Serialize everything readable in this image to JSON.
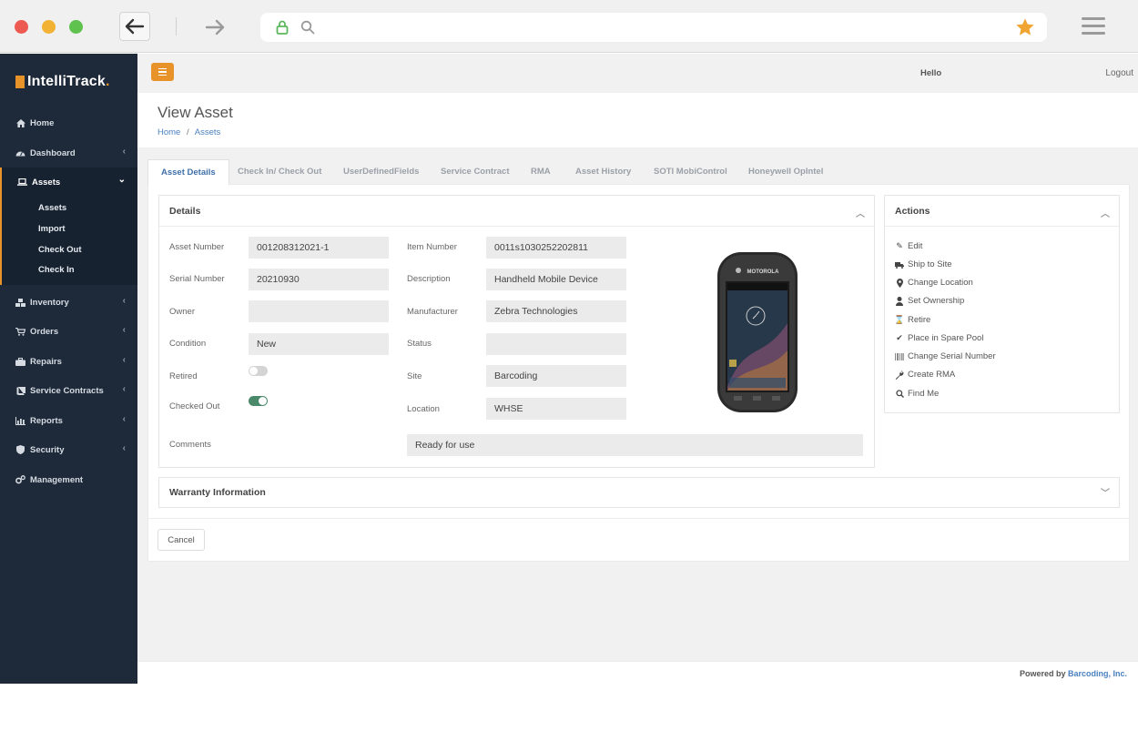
{
  "browser": {
    "colors": {
      "close": "#ed5a52",
      "minimize": "#f2b233",
      "maximize": "#5fc14e",
      "star": "#f0a432",
      "lock": "#5cb85c"
    }
  },
  "sidebar": {
    "brand": "IntelliTrack",
    "brand_dot": ".",
    "items": [
      {
        "label": "Home",
        "icon": "home-icon"
      },
      {
        "label": "Dashboard",
        "icon": "dashboard-icon"
      },
      {
        "label": "Assets",
        "icon": "laptop-icon"
      },
      {
        "label": "Inventory",
        "icon": "cubes-icon"
      },
      {
        "label": "Orders",
        "icon": "cart-icon"
      },
      {
        "label": "Repairs",
        "icon": "toolbox-icon"
      },
      {
        "label": "Service Contracts",
        "icon": "book-icon"
      },
      {
        "label": "Reports",
        "icon": "bar-chart-icon"
      },
      {
        "label": "Security",
        "icon": "shield-icon"
      },
      {
        "label": "Management",
        "icon": "cogs-icon"
      }
    ],
    "assets_sub": [
      "Assets",
      "Import",
      "Check Out",
      "Check In"
    ]
  },
  "topbar": {
    "hello": "Hello",
    "logout": "Logout"
  },
  "page": {
    "title": "View Asset",
    "breadcrumb": {
      "home": "Home",
      "sep": "/",
      "current": "Assets"
    }
  },
  "tabs": [
    "Asset Details",
    "Check In/ Check Out",
    "UserDefinedFields",
    "Service Contract",
    "RMA",
    "Asset History",
    "SOTI MobiControl",
    "Honeywell OpIntel"
  ],
  "details": {
    "title": "Details",
    "asset_number": {
      "label": "Asset Number",
      "value": "001208312021-1"
    },
    "serial_number": {
      "label": "Serial Number",
      "value": "20210930"
    },
    "owner": {
      "label": "Owner",
      "value": ""
    },
    "condition": {
      "label": "Condition",
      "value": "New"
    },
    "retired": {
      "label": "Retired",
      "on": false
    },
    "checked_out": {
      "label": "Checked Out",
      "on": true
    },
    "comments": {
      "label": "Comments",
      "value": "Ready for use"
    },
    "item_number": {
      "label": "Item Number",
      "value": "0011s1030252202811"
    },
    "description": {
      "label": "Description",
      "value": "Handheld Mobile Device"
    },
    "manufacturer": {
      "label": "Manufacturer",
      "value": "Zebra Technologies"
    },
    "status": {
      "label": "Status",
      "value": ""
    },
    "site": {
      "label": "Site",
      "value": "Barcoding"
    },
    "location": {
      "label": "Location",
      "value": "WHSE"
    },
    "device_brand": "MOTOROLA"
  },
  "actions": {
    "title": "Actions",
    "items": [
      {
        "label": "Edit",
        "icon": "pencil-icon"
      },
      {
        "label": "Ship to Site",
        "icon": "truck-icon"
      },
      {
        "label": "Change Location",
        "icon": "map-marker-icon"
      },
      {
        "label": "Set Ownership",
        "icon": "user-icon"
      },
      {
        "label": "Retire",
        "icon": "hourglass-icon"
      },
      {
        "label": "Place in Spare Pool",
        "icon": "check-icon"
      },
      {
        "label": "Change Serial Number",
        "icon": "barcode-icon"
      },
      {
        "label": "Create RMA",
        "icon": "wrench-icon"
      },
      {
        "label": "Find Me",
        "icon": "search-icon"
      }
    ]
  },
  "warranty": {
    "title": "Warranty Information"
  },
  "buttons": {
    "cancel": "Cancel"
  },
  "footer": {
    "powered_by": "Powered by",
    "company": "Barcoding, Inc."
  },
  "theme": {
    "accent": "#e8922a",
    "sidebar_bg": "#1e2a3a",
    "link": "#4a80c0",
    "toggle_on": "#4a8a6a"
  }
}
